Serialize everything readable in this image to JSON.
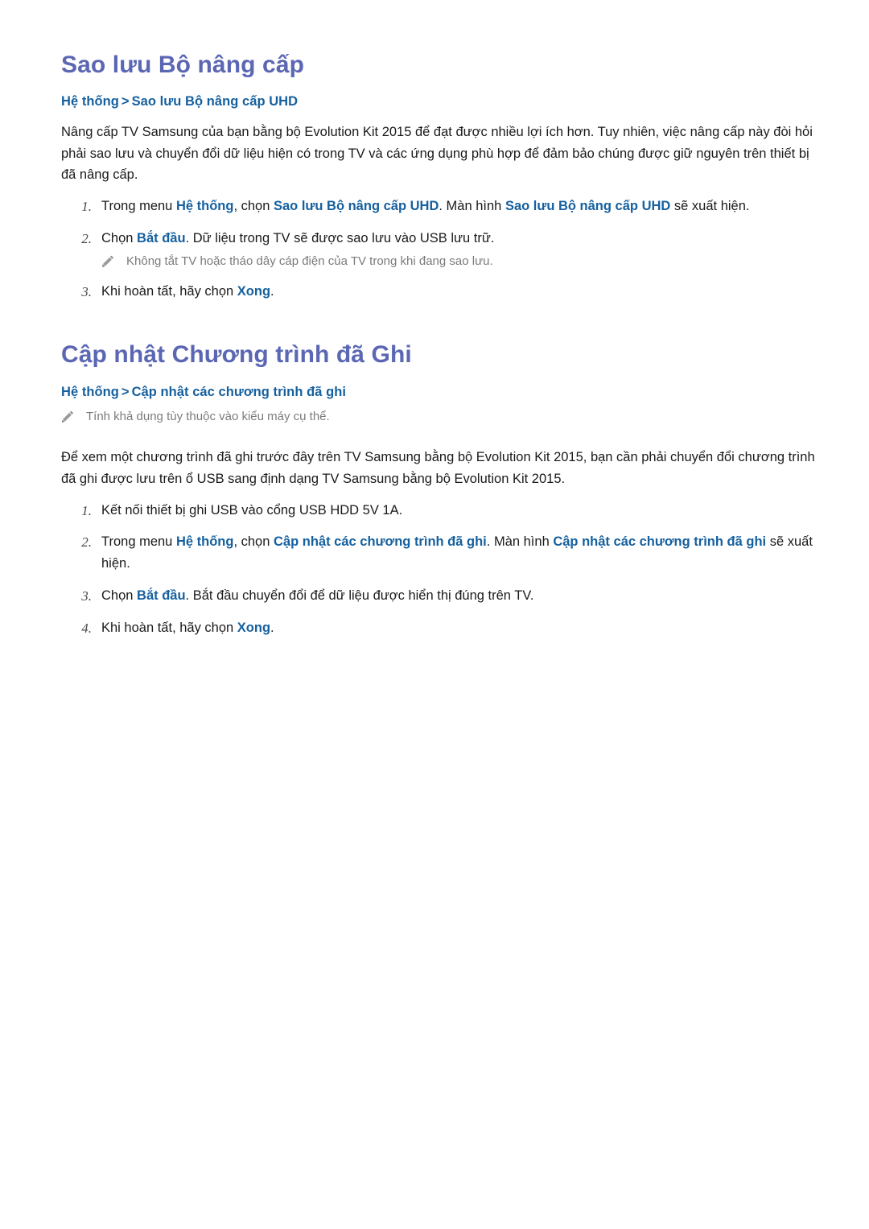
{
  "document": {
    "language": "vi",
    "colors": {
      "section_heading": "#5b67b3",
      "breadcrumb": "#15609f",
      "keyword": "#15609f",
      "body_text": "#1a1a1a",
      "note_text": "#7b7b7b",
      "note_icon": "#8a8a8a",
      "background": "#ffffff"
    }
  },
  "sections": [
    {
      "id": "backup-upgrade",
      "title": "Sao lưu Bộ nâng cấp",
      "breadcrumb": {
        "root": "Hệ thống",
        "separator": ">",
        "leaf": "Sao lưu Bộ nâng cấp UHD"
      },
      "intro": "Nâng cấp TV Samsung của bạn bằng bộ Evolution Kit 2015 để đạt được nhiều lợi ích hơn. Tuy nhiên, việc nâng cấp này đòi hỏi phải sao lưu và chuyển đổi dữ liệu hiện có trong TV và các ứng dụng phù hợp để đảm bảo chúng được giữ nguyên trên thiết bị đã nâng cấp.",
      "steps": [
        {
          "number": "1.",
          "parts": [
            {
              "text": "Trong menu ",
              "bold": false
            },
            {
              "text": "Hệ thống",
              "bold": true
            },
            {
              "text": ", chọn ",
              "bold": false
            },
            {
              "text": "Sao lưu Bộ nâng cấp UHD",
              "bold": true
            },
            {
              "text": ". Màn hình ",
              "bold": false
            },
            {
              "text": "Sao lưu Bộ nâng cấp UHD",
              "bold": true
            },
            {
              "text": " sẽ xuất hiện.",
              "bold": false
            }
          ]
        },
        {
          "number": "2.",
          "parts": [
            {
              "text": "Chọn ",
              "bold": false
            },
            {
              "text": "Bắt đầu",
              "bold": true
            },
            {
              "text": ". Dữ liệu trong TV sẽ được sao lưu vào USB lưu trữ.",
              "bold": false
            }
          ],
          "note": {
            "icon": "pencil-icon",
            "text": "Không tắt TV hoặc tháo dây cáp điện của TV trong khi đang sao lưu."
          }
        },
        {
          "number": "3.",
          "parts": [
            {
              "text": "Khi hoàn tất, hãy chọn ",
              "bold": false
            },
            {
              "text": "Xong",
              "bold": true
            },
            {
              "text": ".",
              "bold": false
            }
          ]
        }
      ]
    },
    {
      "id": "update-recorded-programs",
      "title": "Cập nhật Chương trình đã Ghi",
      "breadcrumb": {
        "root": "Hệ thống",
        "separator": ">",
        "leaf": "Cập nhật các chương trình đã ghi"
      },
      "heading_note": {
        "icon": "pencil-icon",
        "text": "Tính khả dụng tùy thuộc vào kiểu máy cụ thể."
      },
      "intro": "Để xem một chương trình đã ghi trước đây trên TV Samsung bằng bộ Evolution Kit 2015, bạn cần phải chuyển đổi chương trình đã ghi được lưu trên ổ USB sang định dạng TV Samsung bằng bộ Evolution Kit 2015.",
      "steps": [
        {
          "number": "1.",
          "parts": [
            {
              "text": "Kết nối thiết bị ghi USB vào cổng USB HDD 5V 1A.",
              "bold": false
            }
          ]
        },
        {
          "number": "2.",
          "parts": [
            {
              "text": "Trong menu ",
              "bold": false
            },
            {
              "text": "Hệ thống",
              "bold": true
            },
            {
              "text": ", chọn ",
              "bold": false
            },
            {
              "text": "Cập nhật các chương trình đã ghi",
              "bold": true
            },
            {
              "text": ". Màn hình ",
              "bold": false
            },
            {
              "text": "Cập nhật các chương trình đã ghi",
              "bold": true
            },
            {
              "text": " sẽ xuất hiện.",
              "bold": false
            }
          ]
        },
        {
          "number": "3.",
          "parts": [
            {
              "text": "Chọn ",
              "bold": false
            },
            {
              "text": "Bắt đầu",
              "bold": true
            },
            {
              "text": ". Bắt đầu chuyển đổi để dữ liệu được hiển thị đúng trên TV.",
              "bold": false
            }
          ]
        },
        {
          "number": "4.",
          "parts": [
            {
              "text": "Khi hoàn tất, hãy chọn ",
              "bold": false
            },
            {
              "text": "Xong",
              "bold": true
            },
            {
              "text": ".",
              "bold": false
            }
          ]
        }
      ]
    }
  ]
}
